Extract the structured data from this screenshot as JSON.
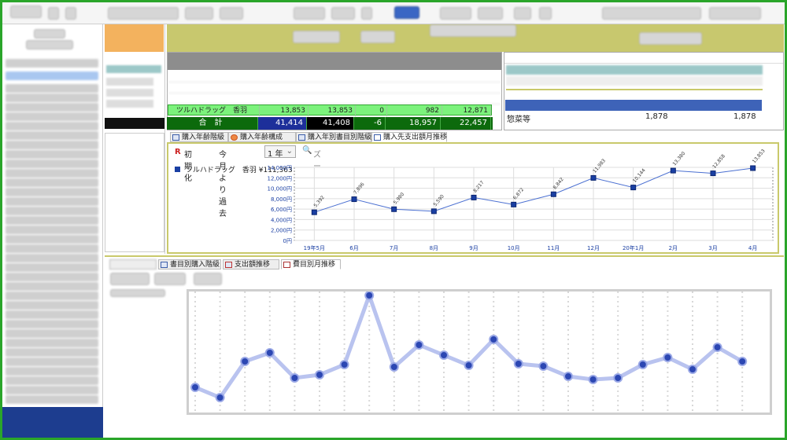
{
  "tabs": [
    {
      "label": "購入年齢階級",
      "active": false
    },
    {
      "label": "購入年齢構成",
      "active": false
    },
    {
      "label": "購入年別書目別階級",
      "active": false
    },
    {
      "label": "購入先支出額月推移",
      "active": true
    }
  ],
  "bottom_tabs": [
    {
      "label": "書目別購入階級"
    },
    {
      "label": "支出額推移"
    },
    {
      "label": "費目別月推移"
    }
  ],
  "controls": {
    "reset_label": "初期化",
    "period_label": "今月より過去",
    "period_value": "1 年",
    "zoom_label": "ズーム解除"
  },
  "summary": {
    "highlight_row": {
      "name": "ツルハドラッグ　香羽",
      "c1": "13,853",
      "c2": "13,853",
      "c3": "0",
      "c4": "982",
      "c5": "12,871"
    },
    "total_row": {
      "label": "合　計",
      "c1": "41,414",
      "c2": "41,408",
      "c3": "-6",
      "c4": "18,957",
      "c5": "22,457"
    }
  },
  "right_summary": {
    "row_label": "惣菜等",
    "v1": "1,878",
    "v2": "1,878"
  },
  "colors": {
    "frame": "#2aa52a",
    "olive": "#c8c86e",
    "total_bg": "#0c6a0c",
    "highlight_bg": "#7cf27c",
    "total_blue": "#1d3d8f",
    "series": "#1a3fa3"
  },
  "chart_data": {
    "type": "line",
    "title": "",
    "legend": "ツルハドラッグ　香羽 ¥111,363",
    "legend_position": "top-left",
    "categories": [
      "19年5月",
      "6月",
      "7月",
      "8月",
      "9月",
      "10月",
      "11月",
      "12月",
      "20年1月",
      "2月",
      "3月",
      "4月"
    ],
    "series": [
      {
        "name": "ツルハドラッグ　香羽",
        "values": [
          5392,
          7896,
          5980,
          5590,
          8217,
          6872,
          8842,
          11983,
          10144,
          13380,
          12858,
          13853
        ],
        "labels": [
          "5,392",
          "7,896",
          "5,980",
          "5,590",
          "8,217",
          "6,872",
          "8,842",
          "11,983",
          "10,144",
          "13,380",
          "12,858",
          "13,853"
        ]
      }
    ],
    "yticks": [
      "0円",
      "2,000円",
      "4,000円",
      "6,000円",
      "8,000円",
      "10,000円",
      "12,000円",
      "14,000円"
    ],
    "ylim": [
      0,
      14000
    ],
    "grid": true
  }
}
